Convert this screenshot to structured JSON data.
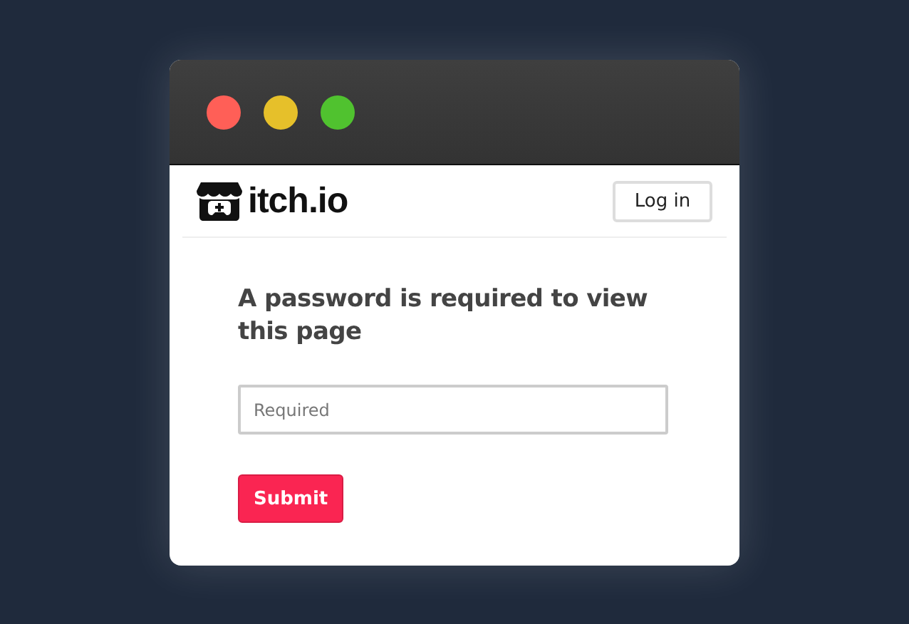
{
  "window": {
    "controls": [
      {
        "color": "#ff5f57"
      },
      {
        "color": "#e6c02a"
      },
      {
        "color": "#50c22f"
      }
    ]
  },
  "header": {
    "logo_text": "itch.io",
    "login_button": "Log in"
  },
  "form": {
    "heading": "A password is required to view this page",
    "password": {
      "placeholder": "Required"
    },
    "submit_button": "Submit"
  }
}
